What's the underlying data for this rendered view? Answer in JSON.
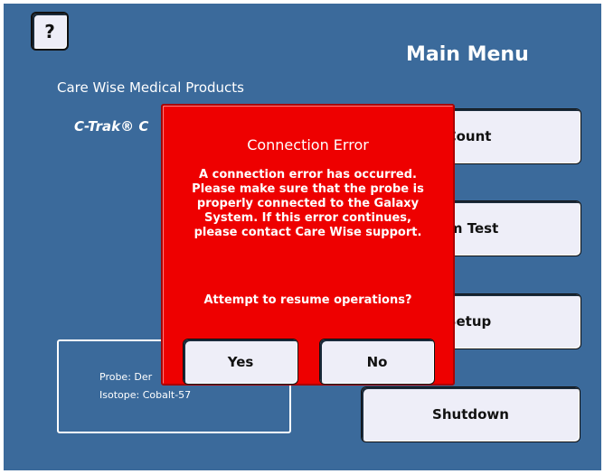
{
  "header": {
    "help_label": "?",
    "title": "Main Menu",
    "company": "Care Wise Medical Products",
    "product": "C-Trak® C"
  },
  "menu": {
    "count_label": "Count",
    "system_test_label": "em Test",
    "setup_label": "Setup",
    "shutdown_label": "Shutdown"
  },
  "info": {
    "probe": "Probe: Der",
    "isotope": "Isotope: Cobalt-57"
  },
  "dialog": {
    "title": "Connection Error",
    "message_lines": [
      "A connection error has occurred.",
      "Please make sure that the probe is",
      "properly connected to the Galaxy",
      "System. If this error continues,",
      "please contact Care Wise support."
    ],
    "question": "Attempt to resume operations?",
    "yes_label": "Yes",
    "no_label": "No"
  },
  "colors": {
    "background": "#3b6a9b",
    "dialog": "#ee0000",
    "button": "#eeeef8"
  }
}
